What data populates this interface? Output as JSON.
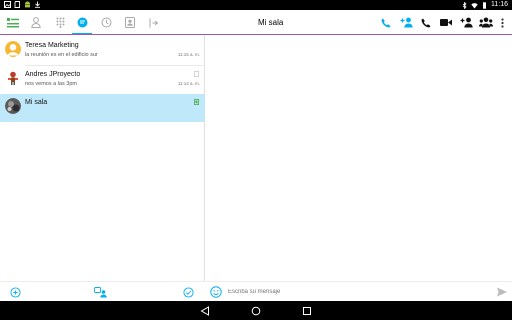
{
  "status_bar": {
    "time": "11:16"
  },
  "toolbar": {
    "tabs": [
      {
        "name": "recent",
        "icon": "recent-icon"
      },
      {
        "name": "contacts",
        "icon": "person-icon"
      },
      {
        "name": "dialpad",
        "icon": "dialpad-icon"
      },
      {
        "name": "chats",
        "icon": "chat-bubble-icon",
        "active": true
      },
      {
        "name": "history",
        "icon": "history-icon"
      },
      {
        "name": "profile",
        "icon": "contact-card-icon"
      },
      {
        "name": "collapse",
        "icon": "collapse-pane-icon"
      }
    ],
    "chat_title": "Mi sala",
    "actions": [
      "call-icon",
      "add-person-icon",
      "phone-icon",
      "video-icon",
      "add-participant-icon",
      "group-icon",
      "more-vert-icon"
    ],
    "accent": "#00aff0",
    "underline": "#9b59b6"
  },
  "conversations": [
    {
      "name": "Teresa Marketing",
      "preview": "la reunión es en el edificio sur",
      "time": "11:15 a. m.",
      "avatar": "orange-person-avatar"
    },
    {
      "name": "Andres JProyecto",
      "preview": "nos vemos a las 3pm",
      "time": "11:14 a. m.",
      "avatar": "character-avatar"
    },
    {
      "name": "Mi sala",
      "preview": "",
      "time": "",
      "avatar": "room-photo-avatar",
      "selected": true
    }
  ],
  "composer": {
    "placeholder": "Escriba su mensaje"
  }
}
